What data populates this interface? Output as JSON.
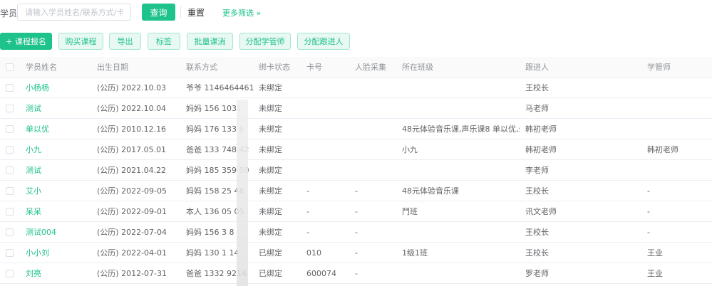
{
  "search": {
    "label": "学员:",
    "placeholder": "请输入学员姓名/联系方式/卡号",
    "query_label": "查询",
    "reset_label": "重置",
    "more_label": "更多筛选 »"
  },
  "toolbar": {
    "enroll_label": "+ 课程报名",
    "buy_course_label": "购买课程",
    "export_label": "导出",
    "tag_label": "标签",
    "batch_cancel_label": "批量课消",
    "assign_manager_label": "分配学管师",
    "assign_referrer_label": "分配跟进人"
  },
  "table": {
    "columns": [
      "学员姓名",
      "出生日期",
      "联系方式",
      "绑卡状态",
      "卡号",
      "人脸采集",
      "所在班级",
      "跟进人",
      "学管师"
    ],
    "rows": [
      {
        "name": "小杨杨",
        "birth": "(公历) 2022.10.03",
        "contact": "爷爷 1146464461",
        "status": "未绑定",
        "card": "",
        "face": "",
        "class": "",
        "referrer": "王校长",
        "manager": ""
      },
      {
        "name": "测试",
        "birth": "(公历) 2022.10.04",
        "contact": "妈妈 156 1031",
        "status": "未绑定",
        "card": "",
        "face": "",
        "class": "",
        "referrer": "马老师",
        "manager": ""
      },
      {
        "name": "单以优",
        "birth": "(公历) 2010.12.16",
        "contact": "妈妈 176 133 6",
        "status": "未绑定",
        "card": "",
        "face": "",
        "class": "48元体验音乐课,声乐课8 单以优,幼...",
        "referrer": "韩初老师",
        "manager": ""
      },
      {
        "name": "小九",
        "birth": "(公历) 2017.05.01",
        "contact": "爸爸 133 748 42",
        "status": "未绑定",
        "card": "",
        "face": "",
        "class": "小九",
        "referrer": "韩初老师",
        "manager": "韩初老师"
      },
      {
        "name": "测试",
        "birth": "(公历) 2021.04.22",
        "contact": "妈妈 185 359 50",
        "status": "未绑定",
        "card": "",
        "face": "",
        "class": "",
        "referrer": "李老师",
        "manager": ""
      },
      {
        "name": "艾小",
        "birth": "(公历) 2022-09-05",
        "contact": "妈妈 158 25 46",
        "status": "未绑定",
        "card": "-",
        "face": "-",
        "class": "48元体验音乐课",
        "referrer": "王校长",
        "manager": "-"
      },
      {
        "name": "呆呆",
        "birth": "(公历) 2022-09-01",
        "contact": "本人 136 05 05",
        "status": "未绑定",
        "card": "-",
        "face": "-",
        "class": "鬥班",
        "referrer": "讯文老师",
        "manager": "-"
      },
      {
        "name": "测试004",
        "birth": "(公历) 2022-07-04",
        "contact": "妈妈 156 3 8",
        "status": "未绑定",
        "card": "-",
        "face": "-",
        "class": "",
        "referrer": "王校长",
        "manager": "-"
      },
      {
        "name": "小小刘",
        "birth": "(公历) 2022-04-01",
        "contact": "妈妈 130 1 14",
        "status": "已绑定",
        "card": "010",
        "face": "-",
        "class": "1级1班",
        "referrer": "王校长",
        "manager": "王业"
      },
      {
        "name": "刘亮",
        "birth": "(公历) 2012-07-31",
        "contact": "爸爸 1332 9214",
        "status": "已绑定",
        "card": "600074",
        "face": "-",
        "class": "",
        "referrer": "罗老师",
        "manager": "王业"
      }
    ]
  }
}
